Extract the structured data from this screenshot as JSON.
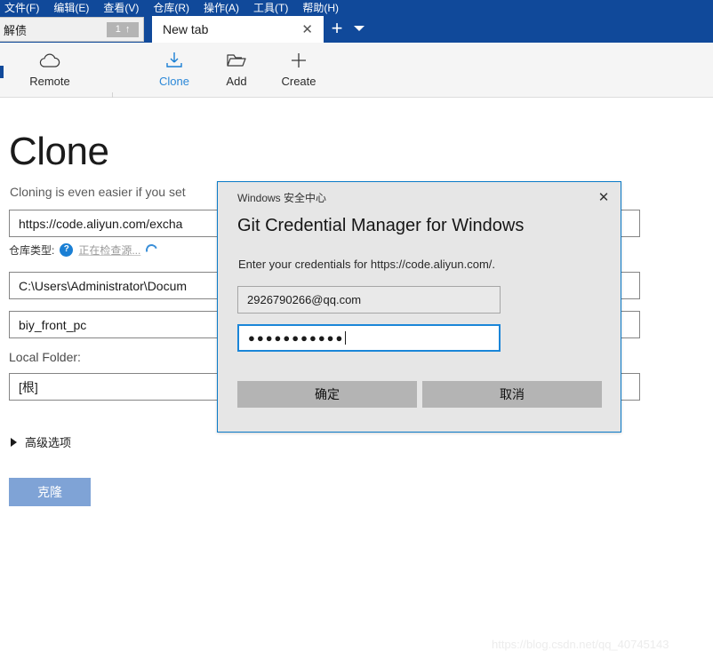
{
  "menubar": {
    "items": [
      {
        "label": "文件(F)"
      },
      {
        "label": "编辑(E)"
      },
      {
        "label": "查看(V)"
      },
      {
        "label": "仓库(R)"
      },
      {
        "label": "操作(A)"
      },
      {
        "label": "工具(T)"
      },
      {
        "label": "帮助(H)"
      }
    ]
  },
  "tabstrip": {
    "repo_tab": {
      "name": "解债",
      "badge_count": "1",
      "badge_arrow": "↑"
    },
    "new_tab": {
      "label": "New tab",
      "close_glyph": "✕"
    },
    "add_tab_glyph": "+",
    "tab_list_caret": "▾"
  },
  "toolbar": {
    "items": [
      {
        "label": "Remote",
        "icon": "cloud-icon",
        "active": false
      },
      {
        "label": "Clone",
        "icon": "download-icon",
        "active": true
      },
      {
        "label": "Add",
        "icon": "folder-icon",
        "active": false
      },
      {
        "label": "Create",
        "icon": "plus-icon",
        "active": false
      }
    ]
  },
  "page": {
    "title": "Clone",
    "subtitle": "Cloning is even easier if you set",
    "url_value": "https://code.aliyun.com/excha",
    "repo_type_label": "仓库类型:",
    "help_glyph": "?",
    "checking_text": "正在检查源...",
    "path_value": "C:\\Users\\Administrator\\Docum",
    "name_value": "biy_front_pc",
    "local_folder_label": "Local Folder:",
    "local_folder_value": "[根]",
    "advanced_label": "高级选项",
    "clone_button_label": "克隆",
    "watermark": "https://blog.csdn.net/qq_40745143"
  },
  "dialog": {
    "title": "Windows 安全中心",
    "close_glyph": "✕",
    "heading": "Git Credential Manager for Windows",
    "description": "Enter your credentials for https://code.aliyun.com/.",
    "username_value": "2926790266@qq.com",
    "password_masked": "●●●●●●●●●●●",
    "ok_label": "确定",
    "cancel_label": "取消"
  },
  "colors": {
    "titlebar_blue": "#10499a",
    "accent_blue": "#0a7ac8",
    "clone_button_blue": "#7fa3d6",
    "dialog_bg": "#e6e6e6",
    "dialog_button_grey": "#b4b4b4"
  }
}
